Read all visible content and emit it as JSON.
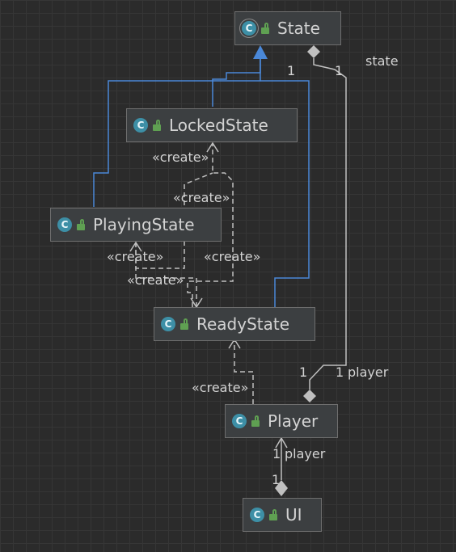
{
  "classes": {
    "state": {
      "name": "State",
      "icon": "C"
    },
    "locked": {
      "name": "LockedState",
      "icon": "C"
    },
    "playing": {
      "name": "PlayingState",
      "icon": "C"
    },
    "ready": {
      "name": "ReadyState",
      "icon": "C"
    },
    "player": {
      "name": "Player",
      "icon": "C"
    },
    "ui": {
      "name": "UI",
      "icon": "C"
    }
  },
  "labels": {
    "create_locked_top": "«create»",
    "create_locked_mid": "«create»",
    "create_playing_left": "«create»",
    "create_playing_right": "«create»",
    "create_ready": "«create»",
    "create_player": "«create»",
    "state_role": "state",
    "state_mult_left": "1",
    "state_mult_right": "1",
    "player_mult_left": "1",
    "player_mult_right": "1",
    "player_role_1": "player",
    "ui_mult_top": "1",
    "ui_mult_bottom": "1",
    "player_role_2": "player"
  },
  "colors": {
    "background": "#2b2b2b",
    "node_fill": "#3c3f41",
    "inheritance": "#4a88d8",
    "dependency": "#c0c0c0",
    "class_icon": "#3d8fa6",
    "lock_icon": "#5fa052"
  }
}
